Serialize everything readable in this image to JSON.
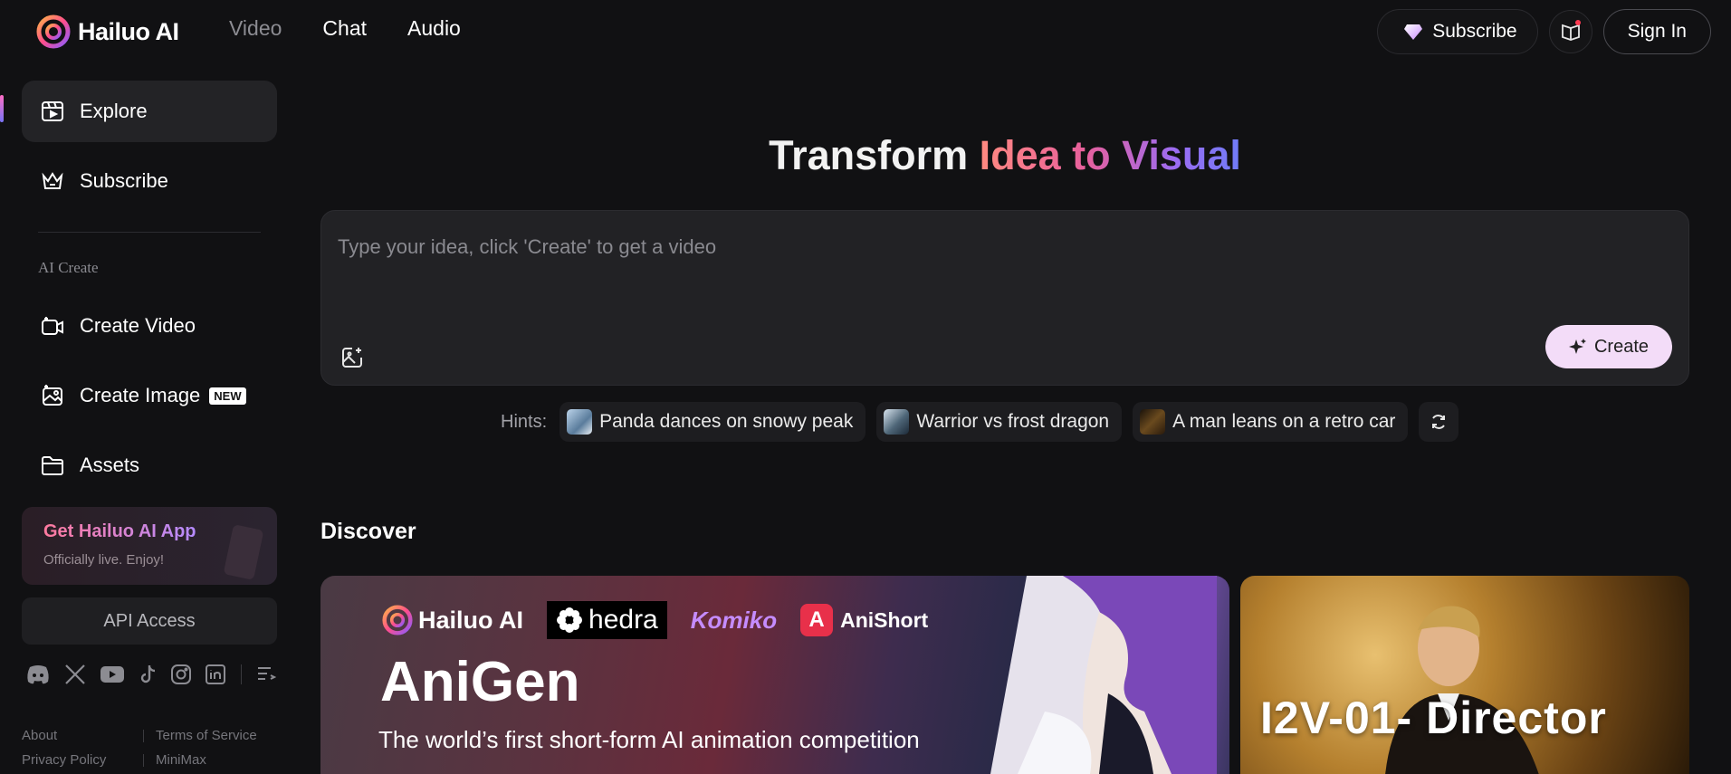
{
  "header": {
    "logo_text": "Hailuo AI",
    "nav": [
      "Video",
      "Chat",
      "Audio"
    ],
    "active_nav": "Video",
    "subscribe_label": "Subscribe",
    "signin_label": "Sign In"
  },
  "sidebar": {
    "items": [
      {
        "label": "Explore",
        "icon": "explore-icon",
        "selected": true
      },
      {
        "label": "Subscribe",
        "icon": "crown-icon"
      }
    ],
    "section_label": "AI Create",
    "create_items": [
      {
        "label": "Create Video",
        "icon": "video-plus-icon"
      },
      {
        "label": "Create Image",
        "icon": "image-plus-icon",
        "badge": "NEW"
      },
      {
        "label": "Assets",
        "icon": "folder-icon"
      }
    ],
    "app_promo": {
      "title": "Get Hailuo AI App",
      "subtitle": "Officially live. Enjoy!"
    },
    "api_label": "API Access",
    "socials": [
      "discord-icon",
      "x-icon",
      "youtube-icon",
      "tiktok-icon",
      "instagram-icon",
      "linkedin-icon",
      "menu-list-icon"
    ],
    "footer": [
      "About",
      "Terms of Service",
      "Privacy Policy",
      "MiniMax"
    ]
  },
  "main": {
    "title_plain": "Transform ",
    "title_grad": "Idea to Visual",
    "prompt_placeholder": "Type your idea, click 'Create' to get a video",
    "create_label": "Create",
    "hints_label": "Hints:",
    "hints": [
      "Panda dances on snowy peak",
      "Warrior vs frost dragon",
      "A man leans on a retro car"
    ],
    "discover_label": "Discover",
    "cards": [
      {
        "brands": [
          "Hailuo AI",
          "hedra",
          "Komiko",
          "AniShort"
        ],
        "title": "AniGen",
        "desc": "The world’s first short-form AI animation competition"
      },
      {
        "title": "I2V-01-     Director"
      }
    ]
  },
  "colors": {
    "accent_pink": "#e8609c",
    "accent_purple": "#9b6cf2",
    "create_bg": "#f3dcf8",
    "background": "#111113"
  }
}
